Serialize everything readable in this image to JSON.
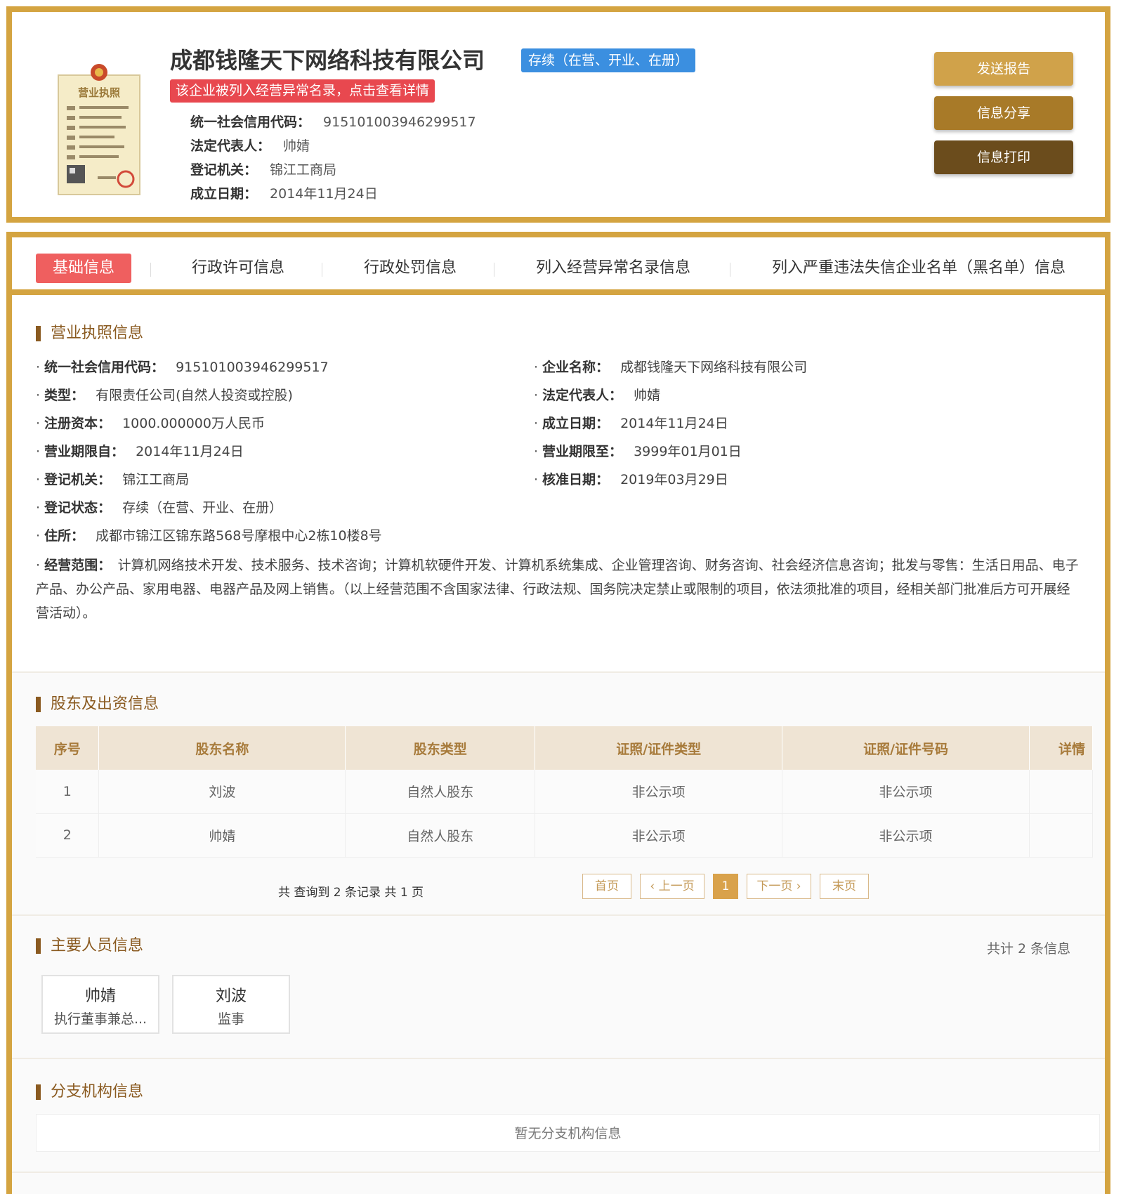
{
  "header": {
    "company_name": "成都钱隆天下网络科技有限公司",
    "status_badge": "存续（在营、开业、在册）",
    "abnormal_banner": "该企业被列入经营异常名录，点击查看详情",
    "info": [
      {
        "label": "统一社会信用代码：",
        "value": "915101003946299517"
      },
      {
        "label": "法定代表人：",
        "value": "帅婧"
      },
      {
        "label": "登记机关：",
        "value": "锦江工商局"
      },
      {
        "label": "成立日期：",
        "value": "2014年11月24日"
      }
    ],
    "license_image_text": "营业执照",
    "buttons": {
      "send": "发送报告",
      "share": "信息分享",
      "print": "信息打印"
    }
  },
  "tabs": [
    {
      "label": "基础信息",
      "active": true
    },
    {
      "label": "行政许可信息"
    },
    {
      "label": "行政处罚信息"
    },
    {
      "label": "列入经营异常名录信息"
    },
    {
      "label": "列入严重违法失信企业名单（黑名单）信息"
    }
  ],
  "license_section": {
    "title": "营业执照信息",
    "left": [
      {
        "label": "统一社会信用代码：",
        "value": "915101003946299517"
      },
      {
        "label": "类型：",
        "value": "有限责任公司(自然人投资或控股)"
      },
      {
        "label": "注册资本：",
        "value": "1000.000000万人民币"
      },
      {
        "label": "营业期限自：",
        "value": "2014年11月24日"
      },
      {
        "label": "登记机关：",
        "value": "锦江工商局"
      },
      {
        "label": "登记状态：",
        "value": "存续（在营、开业、在册）"
      },
      {
        "label": "住所：",
        "value": "成都市锦江区锦东路568号摩根中心2栋10楼8号"
      }
    ],
    "right": [
      {
        "label": "企业名称：",
        "value": "成都钱隆天下网络科技有限公司"
      },
      {
        "label": "法定代表人：",
        "value": "帅婧"
      },
      {
        "label": "成立日期：",
        "value": "2014年11月24日"
      },
      {
        "label": "营业期限至：",
        "value": "3999年01月01日"
      },
      {
        "label": "核准日期：",
        "value": "2019年03月29日"
      }
    ],
    "scope_label": "经营范围：",
    "scope_value": "计算机网络技术开发、技术服务、技术咨询；计算机软硬件开发、计算机系统集成、企业管理咨询、财务咨询、社会经济信息咨询；批发与零售：生活日用品、电子产品、办公产品、家用电器、电器产品及网上销售。（以上经营范围不含国家法律、行政法规、国务院决定禁止或限制的项目，依法须批准的项目，经相关部门批准后方可开展经营活动）。"
  },
  "shareholder_section": {
    "title": "股东及出资信息",
    "columns": [
      "序号",
      "股东名称",
      "股东类型",
      "证照/证件类型",
      "证照/证件号码",
      "详情"
    ],
    "rows": [
      [
        "1",
        "刘波",
        "自然人股东",
        "非公示项",
        "非公示项",
        ""
      ],
      [
        "2",
        "帅婧",
        "自然人股东",
        "非公示项",
        "非公示项",
        ""
      ]
    ],
    "pager_text": "共 查询到 2 条记录 共 1 页",
    "pager": {
      "first": "首页",
      "prev": "上一页",
      "current": "1",
      "next": "下一页",
      "last": "末页"
    }
  },
  "personnel_section": {
    "title": "主要人员信息",
    "count_text": "共计 2 条信息",
    "people": [
      {
        "name": "帅婧",
        "role": "执行董事兼总..."
      },
      {
        "name": "刘波",
        "role": "监事"
      }
    ]
  },
  "branch_section": {
    "title": "分支机构信息",
    "empty_text": "暂无分支机构信息"
  },
  "colors": {
    "gold_border": "#d4a441",
    "active_tab": "#ef5f5f",
    "status_blue": "#3b8fe0",
    "alert_red": "#e8484f"
  }
}
